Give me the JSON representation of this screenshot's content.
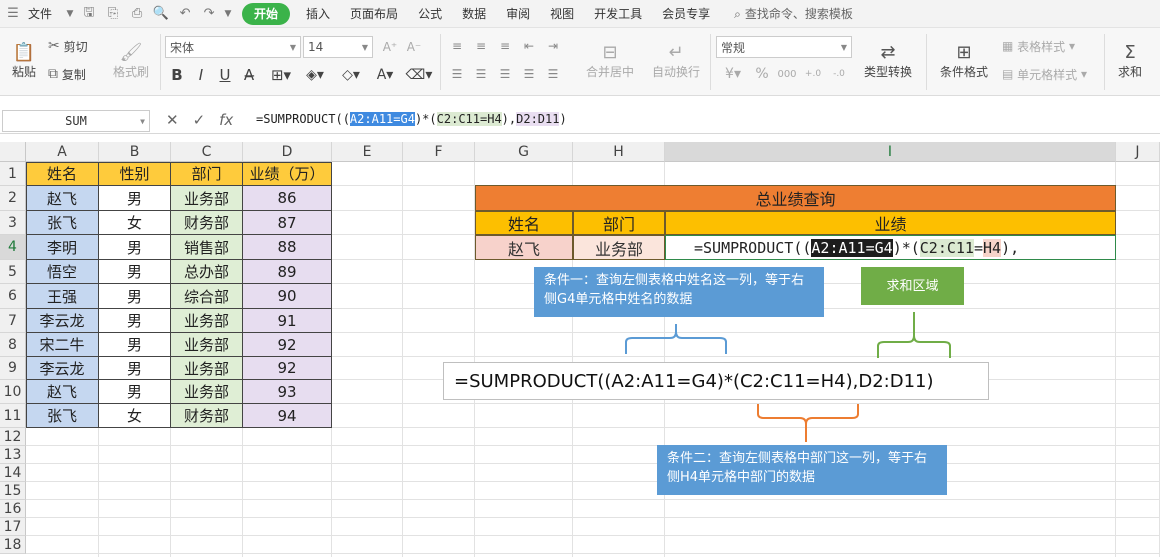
{
  "menubar": {
    "file": "文件",
    "tabs": [
      "开始",
      "插入",
      "页面布局",
      "公式",
      "数据",
      "审阅",
      "视图",
      "开发工具",
      "会员专享"
    ],
    "search": "查找命令、搜索模板"
  },
  "ribbon": {
    "paste": "粘贴",
    "cut": "剪切",
    "copy": "复制",
    "format_painter": "格式刷",
    "font_name": "宋体",
    "font_size": "14",
    "merge_center": "合并居中",
    "wrap_text": "自动换行",
    "number_format": "常规",
    "type_convert": "类型转换",
    "cond_format": "条件格式",
    "table_style": "表格样式",
    "cell_style": "单元格样式",
    "sum": "求和"
  },
  "formula_bar": {
    "name_box": "SUM",
    "fx": "fx",
    "f_pre": "=SUMPRODUCT((",
    "f_range1": "A2:A11=G4",
    "f_mid": ")*(",
    "f_range2": "C2:C11=H4",
    "f_mid2": "),",
    "f_range3": "D2:D11",
    "f_post": ")"
  },
  "columns": [
    "A",
    "B",
    "C",
    "D",
    "E",
    "F",
    "G",
    "H",
    "I",
    "J"
  ],
  "rows": [
    "1",
    "2",
    "3",
    "4",
    "5",
    "6",
    "7",
    "8",
    "9",
    "10",
    "11",
    "12",
    "13",
    "14",
    "15",
    "16",
    "17",
    "18"
  ],
  "table": {
    "headers": [
      "姓名",
      "性别",
      "部门",
      "业绩（万）"
    ],
    "rows": [
      [
        "赵飞",
        "男",
        "业务部",
        "86"
      ],
      [
        "张飞",
        "女",
        "财务部",
        "87"
      ],
      [
        "李明",
        "男",
        "销售部",
        "88"
      ],
      [
        "悟空",
        "男",
        "总办部",
        "89"
      ],
      [
        "王强",
        "男",
        "综合部",
        "90"
      ],
      [
        "李云龙",
        "男",
        "业务部",
        "91"
      ],
      [
        "宋二牛",
        "男",
        "业务部",
        "92"
      ],
      [
        "李云龙",
        "男",
        "业务部",
        "92"
      ],
      [
        "赵飞",
        "男",
        "业务部",
        "93"
      ],
      [
        "张飞",
        "女",
        "财务部",
        "94"
      ]
    ]
  },
  "query": {
    "title": "总业绩查询",
    "h_name": "姓名",
    "h_dept": "部门",
    "h_perf": "业绩",
    "v_name": "赵飞",
    "v_dept": "业务部",
    "f_pre": "=SUMPRODUCT((",
    "f_r1a": "A2:A11",
    "f_eq": "=",
    "f_r1b": "G4",
    "f_mid": ")*(",
    "f_r2a": "C2:C11",
    "f_eq2": "=",
    "f_r2b": "H4",
    "f_post": "),"
  },
  "callouts": {
    "cond1": "条件一：查询左侧表格中姓名这一列，等于右侧G4单元格中姓名的数据",
    "sum_area": "求和区域",
    "formula": "=SUMPRODUCT((A2:A11=G4)*(C2:C11=H4),D2:D11)",
    "cond2": "条件二：查询左侧表格中部门这一列，等于右侧H4单元格中部门的数据"
  },
  "colors": {
    "active_tab": "#3bb34a",
    "header_fill": "#fecb3c",
    "title_fill": "#ee7e32",
    "callout_blue": "#5b9bd5",
    "callout_green": "#70ad47",
    "brace_orange": "#ed7d31"
  }
}
